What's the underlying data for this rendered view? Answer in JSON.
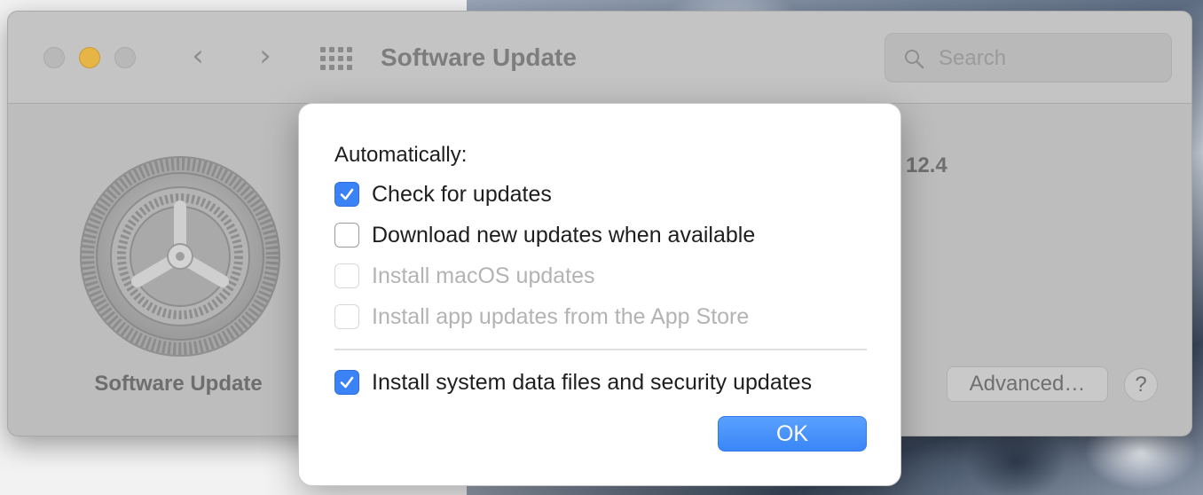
{
  "window": {
    "title": "Software Update",
    "nav_back": "‹",
    "nav_forward": "›"
  },
  "search": {
    "placeholder": "Search"
  },
  "pane": {
    "label": "Software Update",
    "status_partial": "y 12.4",
    "advanced_label": "Advanced…",
    "help_label": "?"
  },
  "sheet": {
    "heading": "Automatically:",
    "options": [
      {
        "label": "Check for updates",
        "checked": true,
        "enabled": true
      },
      {
        "label": "Download new updates when available",
        "checked": false,
        "enabled": true
      },
      {
        "label": "Install macOS updates",
        "checked": false,
        "enabled": false
      },
      {
        "label": "Install app updates from the App Store",
        "checked": false,
        "enabled": false
      },
      {
        "label": "Install system data files and security updates",
        "checked": true,
        "enabled": true
      }
    ],
    "ok_label": "OK"
  },
  "colors": {
    "accent": "#3b82f6",
    "traffic_minimize": "#e7b446"
  }
}
